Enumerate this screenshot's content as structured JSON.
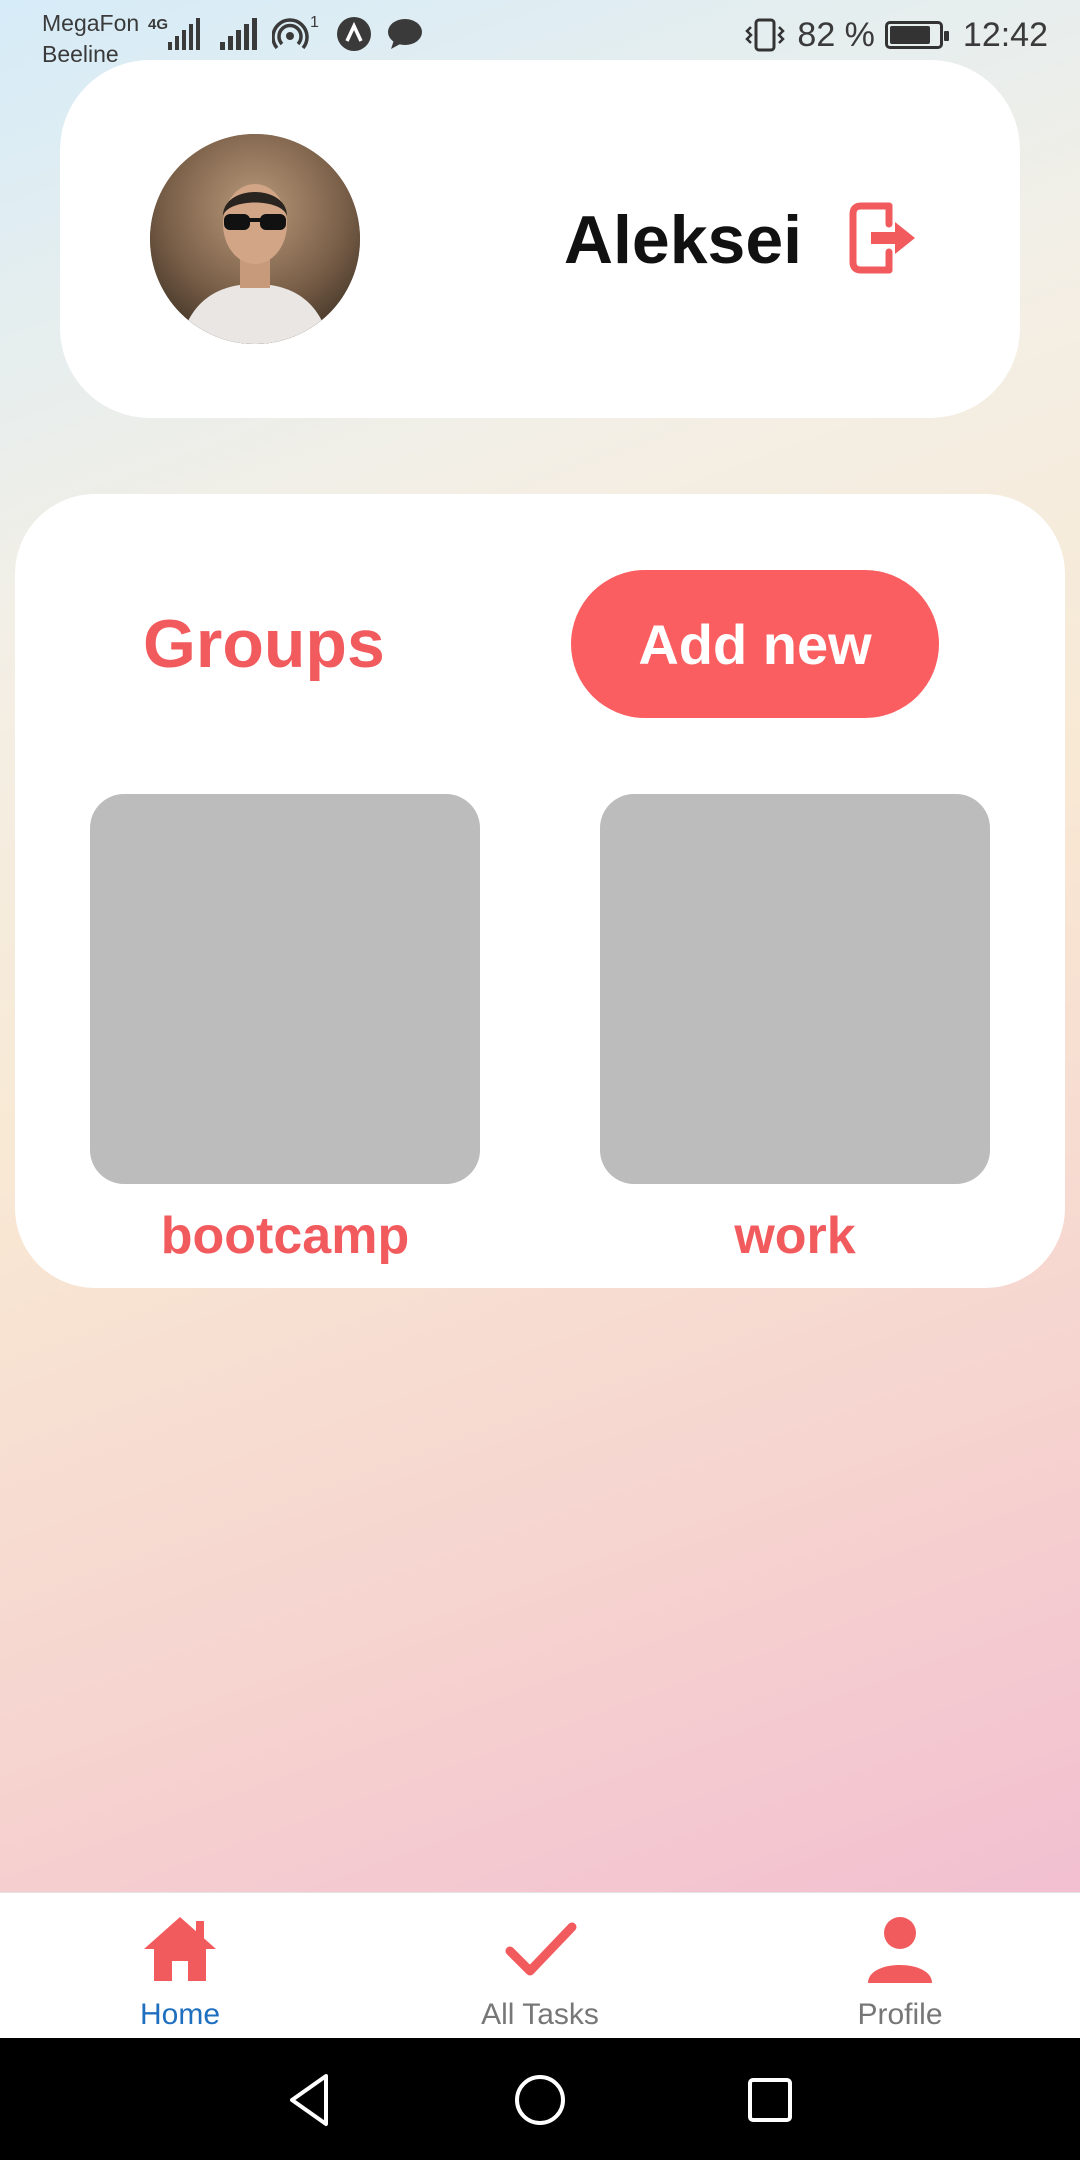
{
  "status_bar": {
    "carrier_1": "MegaFon",
    "carrier_2": "Beeline",
    "network_type": "4G",
    "hotspot_count": "1",
    "battery": "82 %",
    "time": "12:42"
  },
  "profile": {
    "name": "Aleksei"
  },
  "groups": {
    "title": "Groups",
    "add_button": "Add new",
    "items": [
      {
        "label": "bootcamp"
      },
      {
        "label": "work"
      }
    ]
  },
  "bottom_nav": {
    "items": [
      {
        "label": "Home",
        "icon": "home-icon",
        "active": true
      },
      {
        "label": "All Tasks",
        "icon": "check-icon",
        "active": false
      },
      {
        "label": "Profile",
        "icon": "person-icon",
        "active": false
      }
    ]
  },
  "colors": {
    "accent": "#fb5e60",
    "active_nav": "#1f6fbf",
    "tile_placeholder": "#bcbcbc"
  }
}
